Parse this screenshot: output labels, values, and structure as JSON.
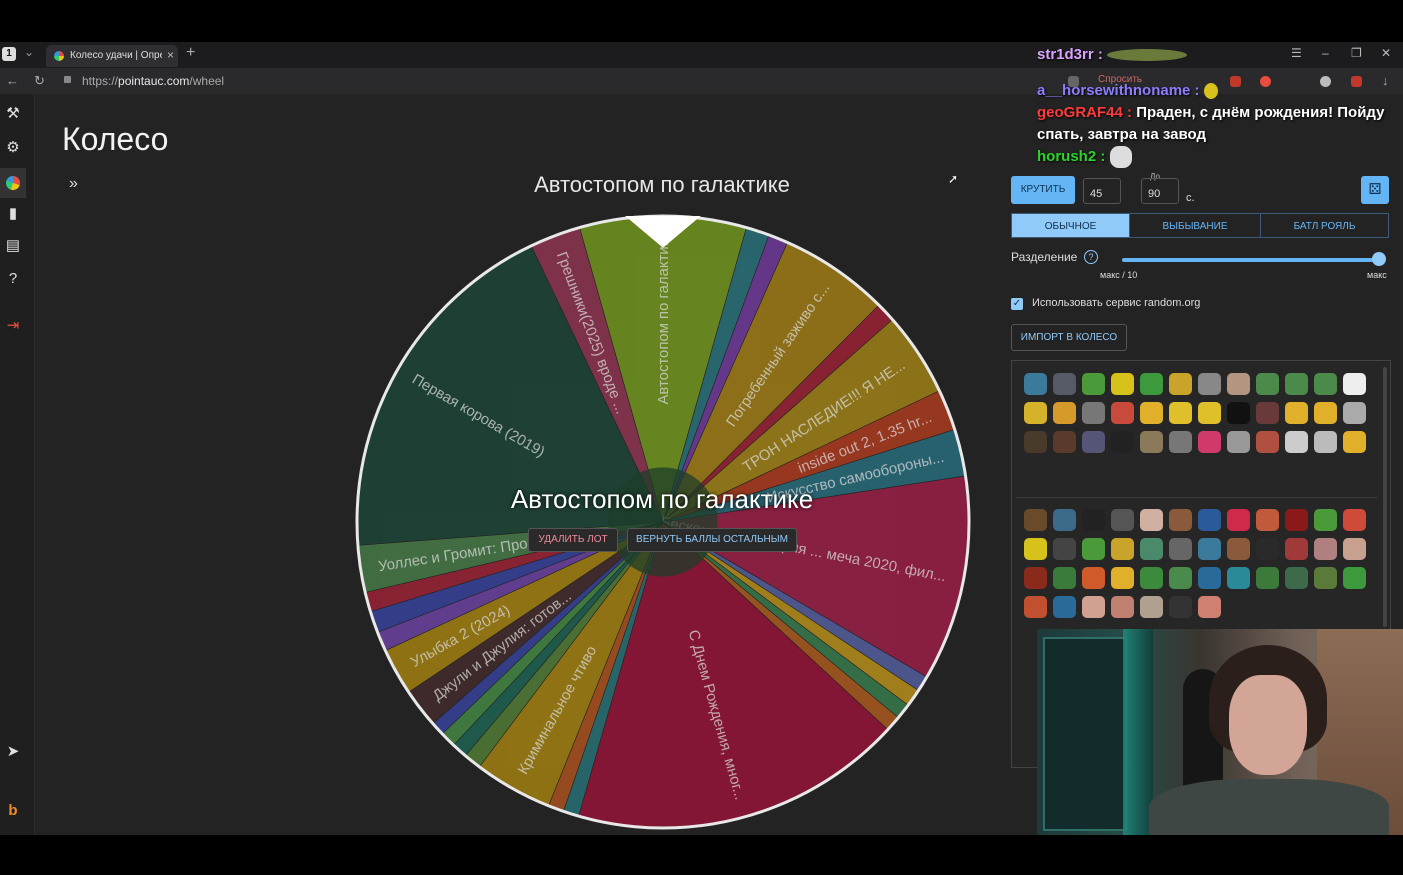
{
  "browser": {
    "tab_number": "1",
    "tab_title": "Колесо удачи | Опреде",
    "tab_close": "×",
    "new_tab": "+",
    "url_prefix": "https://",
    "url_domain": "pointauc.com",
    "url_path": "/wheel",
    "ask_label": "Спросить",
    "window_controls": [
      "☰",
      "–",
      "❐",
      "✕"
    ]
  },
  "sidebar": {
    "icons": [
      "auction-gavel-icon",
      "settings-gear-icon",
      "wheel-icon",
      "stats-chart-icon",
      "clipboard-icon",
      "help-icon",
      "logout-icon",
      "telegram-icon",
      "boosty-icon"
    ]
  },
  "main": {
    "page_title": "Колесо",
    "expand_icon": "»",
    "wheel_title": "Автостопом по галактике",
    "winner_text": "Автостопом по галактике",
    "delete_button": "УДАЛИТЬ ЛОТ",
    "return_button": "ВЕРНУТЬ БАЛЛЫ ОСТАЛЬНЫМ"
  },
  "wheel": {
    "rotation_deg": -90,
    "slices": [
      {
        "label": "Автостопом по галакти...",
        "value": 8.5,
        "color": "#6a8a1f"
      },
      {
        "label": "",
        "value": 1.2,
        "color": "#2c7f8a"
      },
      {
        "label": "",
        "value": 1.0,
        "color": "#7d3fb0"
      },
      {
        "label": "Погребенный заживо с...",
        "value": 5.6,
        "color": "#b58d14"
      },
      {
        "label": "",
        "value": 1.0,
        "color": "#b0233a"
      },
      {
        "label": "ТРОН НАСЛЕДИЕ!!! Я НЕ...",
        "value": 4.3,
        "color": "#b59216"
      },
      {
        "label": "inside out 2, 1.35 hr...",
        "value": 2.1,
        "color": "#c4401f"
      },
      {
        "label": "Искусство самообороны...",
        "value": 2.4,
        "color": "#2b7a8c"
      },
      {
        "label": "Бесконечная история ... меча 2020, фил...",
        "value": 10.5,
        "color": "#b01f4d"
      },
      {
        "label": "",
        "value": 0.8,
        "color": "#5e6ab3"
      },
      {
        "label": "",
        "value": 0.9,
        "color": "#d1a21a"
      },
      {
        "label": "",
        "value": 0.8,
        "color": "#3c8a55"
      },
      {
        "label": "",
        "value": 0.8,
        "color": "#c2661f"
      },
      {
        "label": "С Днем Рождения, мног...",
        "value": 17.0,
        "color": "#a8123c"
      },
      {
        "label": "",
        "value": 0.8,
        "color": "#2a7f85"
      },
      {
        "label": "",
        "value": 0.8,
        "color": "#c25a1f"
      },
      {
        "label": "Криминальное чтиво",
        "value": 4.0,
        "color": "#b8910f"
      },
      {
        "label": "",
        "value": 0.9,
        "color": "#5a8c3a"
      },
      {
        "label": "",
        "value": 0.8,
        "color": "#1e6f5c"
      },
      {
        "label": "",
        "value": 0.8,
        "color": "#4a9a4a"
      },
      {
        "label": "",
        "value": 0.7,
        "color": "#3b49b0"
      },
      {
        "label": "Джули и Джулия: готов...",
        "value": 2.0,
        "color": "#4a2f2f"
      },
      {
        "label": "Улыбка 2 (2024)",
        "value": 2.4,
        "color": "#b8910f"
      },
      {
        "label": "",
        "value": 1.0,
        "color": "#7a48b8"
      },
      {
        "label": "",
        "value": 1.1,
        "color": "#3b49b0"
      },
      {
        "label": "",
        "value": 1.0,
        "color": "#b0233a"
      },
      {
        "label": "Уоллес и Громит: Прок...",
        "value": 2.4,
        "color": "#4e8a4e"
      },
      {
        "label": "Первая корова (2019)",
        "value": 18.5,
        "color": "#1e4d3c"
      },
      {
        "label": "Грешники(2025) вроде ...",
        "value": 2.6,
        "color": "#a33a5a"
      }
    ]
  },
  "chat": {
    "messages": [
      {
        "user": "str1d3rr :",
        "text": ""
      },
      {
        "user": "a__horsewithnoname :",
        "text": ""
      },
      {
        "user": "geoGRAF44 :",
        "text": "Праден, с днём рождения! Пойду спать, завтра на завод"
      },
      {
        "user": "horush2 :",
        "text": ""
      }
    ]
  },
  "controls": {
    "spin_button": "КРУТИТЬ",
    "spin_from": "45",
    "to_label": "До",
    "spin_to": "90",
    "seconds_label": "с.",
    "modes": [
      "ОБЫЧНОЕ",
      "ВЫБЫВАНИЕ",
      "БАТЛ РОЯЛЬ"
    ],
    "active_mode": "ОБЫЧНОЕ",
    "split_label": "Разделение",
    "split_left": "макс / 10",
    "split_right": "макс",
    "split_level": 1.0,
    "random_org_label": "Использовать сервис random.org",
    "random_org_checked": true,
    "import_button": "ИМПОРТ В КОЛЕСО"
  },
  "emotes": {
    "set1_colors": [
      "#3b7a9a",
      "#555a66",
      "#4a9a3a",
      "#d6c21a",
      "#3c9a3c",
      "#caa42a",
      "#888",
      "#b39680",
      "#4c8a4c",
      "#4c8a4c",
      "#4c8a4c",
      "#eee",
      "#d6b12a",
      "#d69a2a",
      "#777",
      "#c74a3a",
      "#e0b02a",
      "#e0c02a",
      "#e0c02a",
      "#111",
      "#6a3a3a",
      "#e0b02a",
      "#e0b02a",
      "#aaa",
      "#4a3a2a",
      "#5a3a2a",
      "#557",
      "#222",
      "#8a7a5a",
      "#777",
      "#d03a6a",
      "#999",
      "#b05040",
      "#ccc",
      "#bbb",
      "#e0b02a"
    ],
    "set2_colors": [
      "#6a4a2a",
      "#3b6a8a",
      "#222",
      "#555",
      "#d0b0a0",
      "#8a5a3a",
      "#2a5a9a",
      "#d02a4a",
      "#c05a3a",
      "#8a1a1a",
      "#4a9a3a",
      "#d04a3a",
      "#d6c21a",
      "#444",
      "#4a9a3a",
      "#caa42a",
      "#4a8a6a",
      "#666",
      "#3b7a9a",
      "#8a5a3a",
      "#2a2a2a",
      "#a03a3a",
      "#b08080",
      "#c8a090",
      "#8a2a1a",
      "#3a7a3a",
      "#d05a2a",
      "#e0b02a",
      "#3c8a3c",
      "#4a8a4a",
      "#2a6a9a",
      "#2a8a9a",
      "#3c7a3c",
      "#3c6a4a",
      "#5a7a3a",
      "#3c9a3c",
      "#c05030",
      "#2a6a9a",
      "#d0a090",
      "#c08070",
      "#b0a090",
      "#333",
      "#d08070"
    ]
  }
}
